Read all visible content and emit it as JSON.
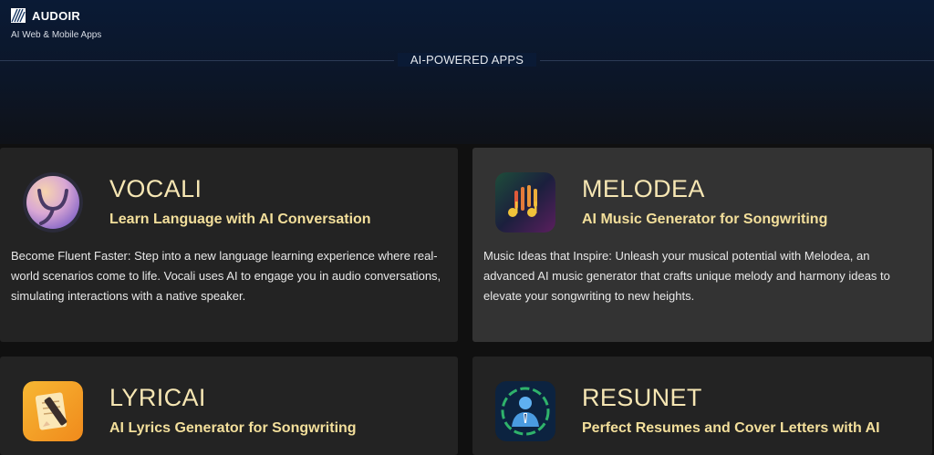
{
  "header": {
    "brand_name": "AUDOIR",
    "brand_tagline": "AI Web & Mobile Apps"
  },
  "section": {
    "title": "AI-POWERED APPS"
  },
  "apps": [
    {
      "name": "VOCALI",
      "tagline": "Learn Language with AI Conversation",
      "description": "Become Fluent Faster: Step into a new language learning experience where real-world scenarios come to life. Vocali uses AI to engage you in audio conversations, simulating interactions with a native speaker.",
      "icon": "vocali-logo-icon"
    },
    {
      "name": "MELODEA",
      "tagline": "AI Music Generator for Songwriting",
      "description": "Music Ideas that Inspire: Unleash your musical potential with Melodea, an advanced AI music generator that crafts unique melody and harmony ideas to elevate your songwriting to new heights.",
      "icon": "melodea-logo-icon"
    },
    {
      "name": "LYRICAI",
      "tagline": "AI Lyrics Generator for Songwriting",
      "description": "",
      "icon": "lyricai-logo-icon"
    },
    {
      "name": "RESUNET",
      "tagline": "Perfect Resumes and Cover Letters with AI",
      "description": "",
      "icon": "resunet-logo-icon"
    }
  ],
  "colors": {
    "hero_top": "#0a1a35",
    "card_bg": "#232323",
    "card_hover_bg": "#333333",
    "title_color": "#f6e6b3",
    "tagline_color": "#f3df9b"
  }
}
